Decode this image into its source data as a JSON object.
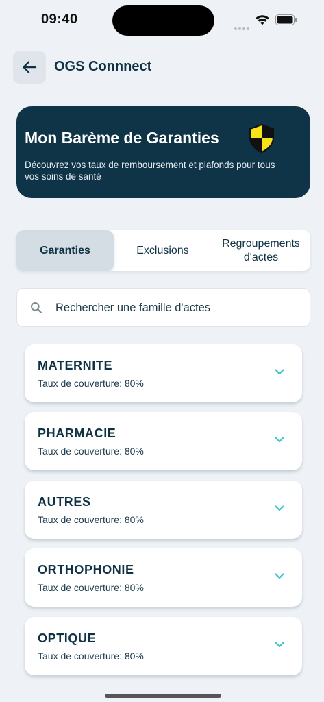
{
  "status_bar": {
    "time": "09:40"
  },
  "header": {
    "title": "OGS Connnect"
  },
  "banner": {
    "title": "Mon Barème de Garanties",
    "description": "Découvrez vos taux de remboursement et plafonds pour tous vos soins de santé"
  },
  "tabs": [
    {
      "label": "Garanties",
      "active": true
    },
    {
      "label": "Exclusions",
      "active": false
    },
    {
      "label": "Regroupements\nd'actes",
      "active": false
    }
  ],
  "search": {
    "placeholder": "Rechercher une famille d'actes",
    "value": ""
  },
  "categories": [
    {
      "title": "MATERNITE",
      "coverage": "Taux de couverture: 80%"
    },
    {
      "title": "PHARMACIE",
      "coverage": "Taux de couverture: 80%"
    },
    {
      "title": "AUTRES",
      "coverage": "Taux de couverture: 80%"
    },
    {
      "title": "ORTHOPHONIE",
      "coverage": "Taux de couverture: 80%"
    },
    {
      "title": "OPTIQUE",
      "coverage": "Taux de couverture: 80%"
    }
  ],
  "colors": {
    "primary": "#0f3447",
    "background": "#eef2f6",
    "accent_chevron": "#3fc4c4",
    "shield_yellow": "#f7e31a",
    "active_tab": "#d4dde3"
  },
  "icons": [
    "back-arrow-icon",
    "shield-icon",
    "search-icon",
    "chevron-down-icon",
    "wifi-icon",
    "battery-icon"
  ]
}
